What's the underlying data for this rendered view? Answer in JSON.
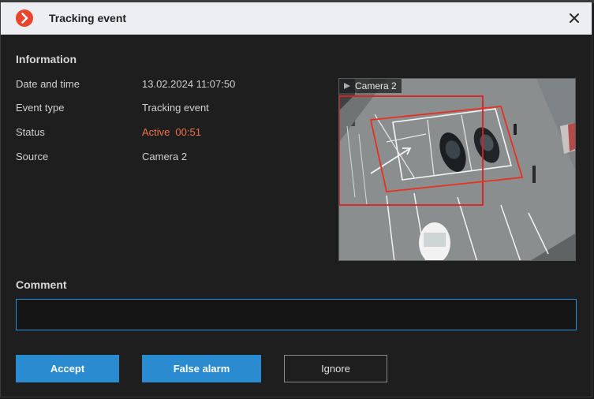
{
  "dialog": {
    "title": "Tracking event",
    "logo_icon": "app-logo-icon",
    "close_icon": "close-icon"
  },
  "information": {
    "heading": "Information",
    "rows": [
      {
        "label": "Date and time",
        "value": "13.02.2024 11:07:50"
      },
      {
        "label": "Event type",
        "value": "Tracking event"
      },
      {
        "label": "Status",
        "value": "Active",
        "extra": "00:51"
      },
      {
        "label": "Source",
        "value": "Camera 2"
      }
    ]
  },
  "preview": {
    "camera_label": "Camera 2"
  },
  "comment": {
    "heading": "Comment",
    "value": "",
    "placeholder": ""
  },
  "buttons": {
    "accept": "Accept",
    "false_alarm": "False alarm",
    "ignore": "Ignore"
  },
  "colors": {
    "accent": "#2b8bd0",
    "status_active": "#f0734a",
    "logo": "#e8452c",
    "detection": "#e02020"
  }
}
